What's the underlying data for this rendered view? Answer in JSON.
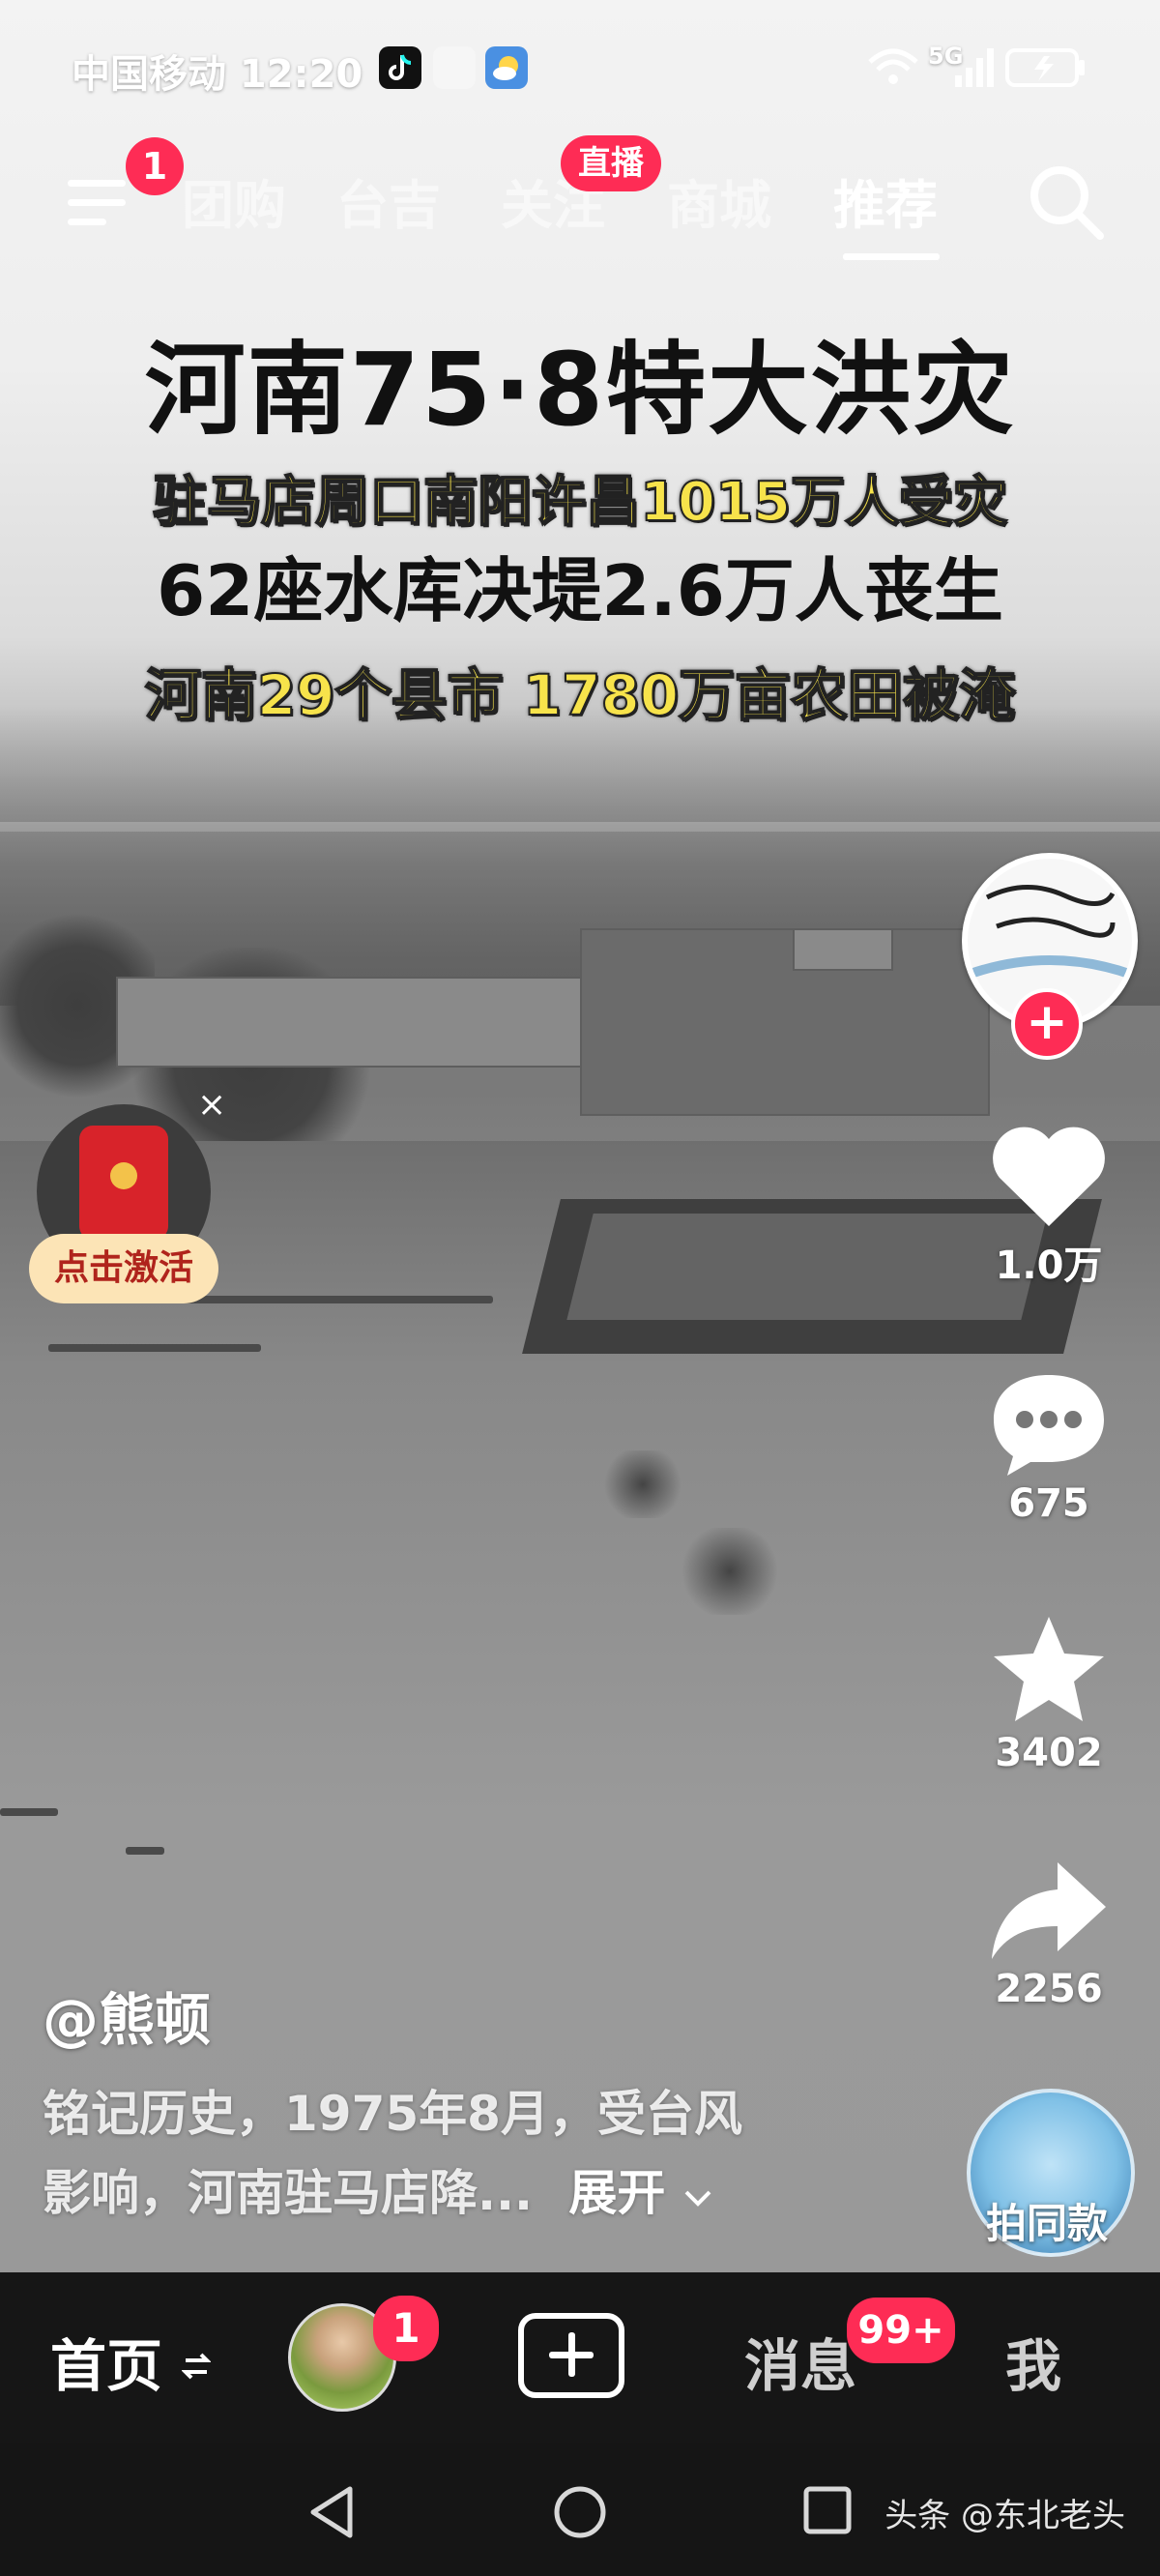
{
  "status_bar": {
    "carrier_time": "中国移动 12:20",
    "signal_label": "5G"
  },
  "top_nav": {
    "menu_badge": "1",
    "tabs": [
      {
        "label": "团购"
      },
      {
        "label": "台吉"
      },
      {
        "label": "关注",
        "badge": "直播"
      },
      {
        "label": "商城"
      },
      {
        "label": "推荐",
        "active": true
      }
    ]
  },
  "overlay_text": {
    "title": "河南75·8特大洪灾",
    "line1": "驻马店周口南阳许昌1015万人受灾",
    "line2": "62座水库决堤2.6万人丧生",
    "line3": "河南29个县市 1780万亩农田被淹"
  },
  "right_rail": {
    "like_count": "1.0万",
    "comment_count": "675",
    "favorite_count": "3402",
    "share_count": "2256",
    "follow_symbol": "+"
  },
  "redpacket": {
    "button_label": "点击激活",
    "close_symbol": "×"
  },
  "video_info": {
    "author": "@熊顿",
    "description_line1": "铭记历史，1975年8月，受台风",
    "description_line2": "影响，河南驻马店降...",
    "expand_label": "展开",
    "music_label": "拍同款"
  },
  "bottom_nav": {
    "home_label": "首页",
    "friend_badge": "1",
    "messages_label": "消息",
    "messages_badge": "99+",
    "me_label": "我"
  },
  "watermark": "头条 @东北老头",
  "colors": {
    "accent_red": "#fe2c55",
    "caption_yellow": "#f7e34b"
  }
}
